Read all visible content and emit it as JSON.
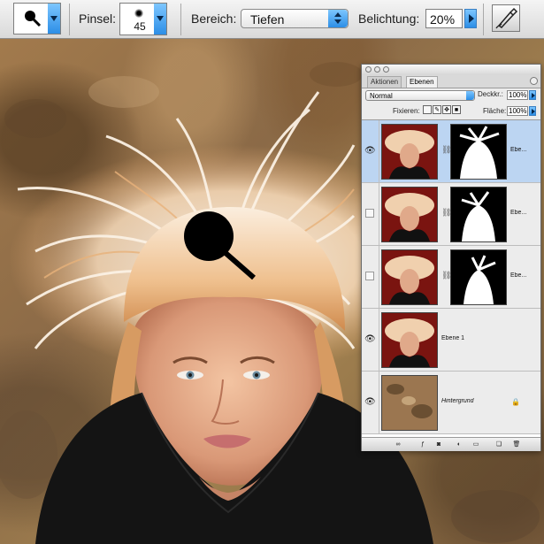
{
  "options_bar": {
    "tool_icon": "magnifier-icon",
    "brush_label": "Pinsel:",
    "brush_size": "45",
    "range_label": "Bereich:",
    "range_value": "Tiefen",
    "exposure_label": "Belichtung:",
    "exposure_value": "20%",
    "airbrush_icon": "airbrush-icon"
  },
  "canvas": {
    "cursor_icon": "magnifier-cursor-icon"
  },
  "layers_panel": {
    "tabs": [
      "Aktionen",
      "Ebenen"
    ],
    "active_tab": "Ebenen",
    "blend_mode": "Normal",
    "opacity_label": "Deckkr.:",
    "opacity_value": "100%",
    "lock_label": "Fixieren:",
    "fill_label": "Fläche:",
    "fill_value": "100%",
    "layers": [
      {
        "name": "Ebe...",
        "visible": true,
        "selected": true,
        "has_mask": true
      },
      {
        "name": "Ebe...",
        "visible": false,
        "selected": false,
        "has_mask": true
      },
      {
        "name": "Ebe...",
        "visible": false,
        "selected": false,
        "has_mask": true
      },
      {
        "name": "Ebene 1",
        "visible": true,
        "selected": false,
        "has_mask": false
      },
      {
        "name": "Hintergrund",
        "visible": true,
        "selected": false,
        "has_mask": false,
        "locked": true
      }
    ],
    "footer_icons": [
      "link-layers-icon",
      "layer-style-icon",
      "add-mask-icon",
      "adjustment-layer-icon",
      "new-group-icon",
      "new-layer-icon",
      "trash-icon"
    ]
  },
  "colors": {
    "accent_blue": "#2c8ee6",
    "selected_row": "#bcd5f2"
  }
}
